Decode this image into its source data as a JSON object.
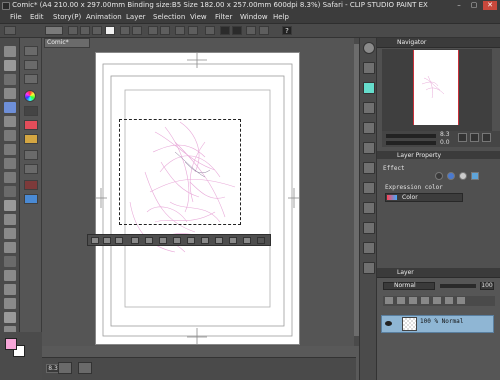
{
  "window": {
    "title": "Comic* (A4 210.00 x 297.00mm Binding size:B5 Size 182.00 x 257.00mm 600dpi 8.3%) Safari - CLIP STUDIO PAINT EX",
    "controls": [
      "–",
      "▢",
      "✕"
    ]
  },
  "menu": [
    "File",
    "Edit",
    "Story(P)",
    "Animation",
    "Layer",
    "Selection",
    "View",
    "Filter",
    "Window",
    "Help"
  ],
  "document": {
    "tab_label": "Comic*"
  },
  "command_bar": {
    "help_glyph": "?"
  },
  "status": {
    "zoom": "8.3"
  },
  "panels": {
    "navigator": {
      "title": "Navigator",
      "zoom_value": "8.3",
      "angle_value": "0.0"
    },
    "layer_property": {
      "title": "Layer Property",
      "effect_label": "Effect",
      "expression_color_label": "Expression color",
      "expression_color_value": "Color"
    },
    "layer": {
      "title": "Layer",
      "blend_mode": "Normal",
      "opacity": "100",
      "layers": [
        {
          "name": "100 % Normal"
        }
      ]
    }
  },
  "colors": {
    "foreground": "#f7a6d8",
    "background": "#ffffff",
    "selected_layer": "#8fb6d4",
    "sketch": "#e8a8d8"
  }
}
